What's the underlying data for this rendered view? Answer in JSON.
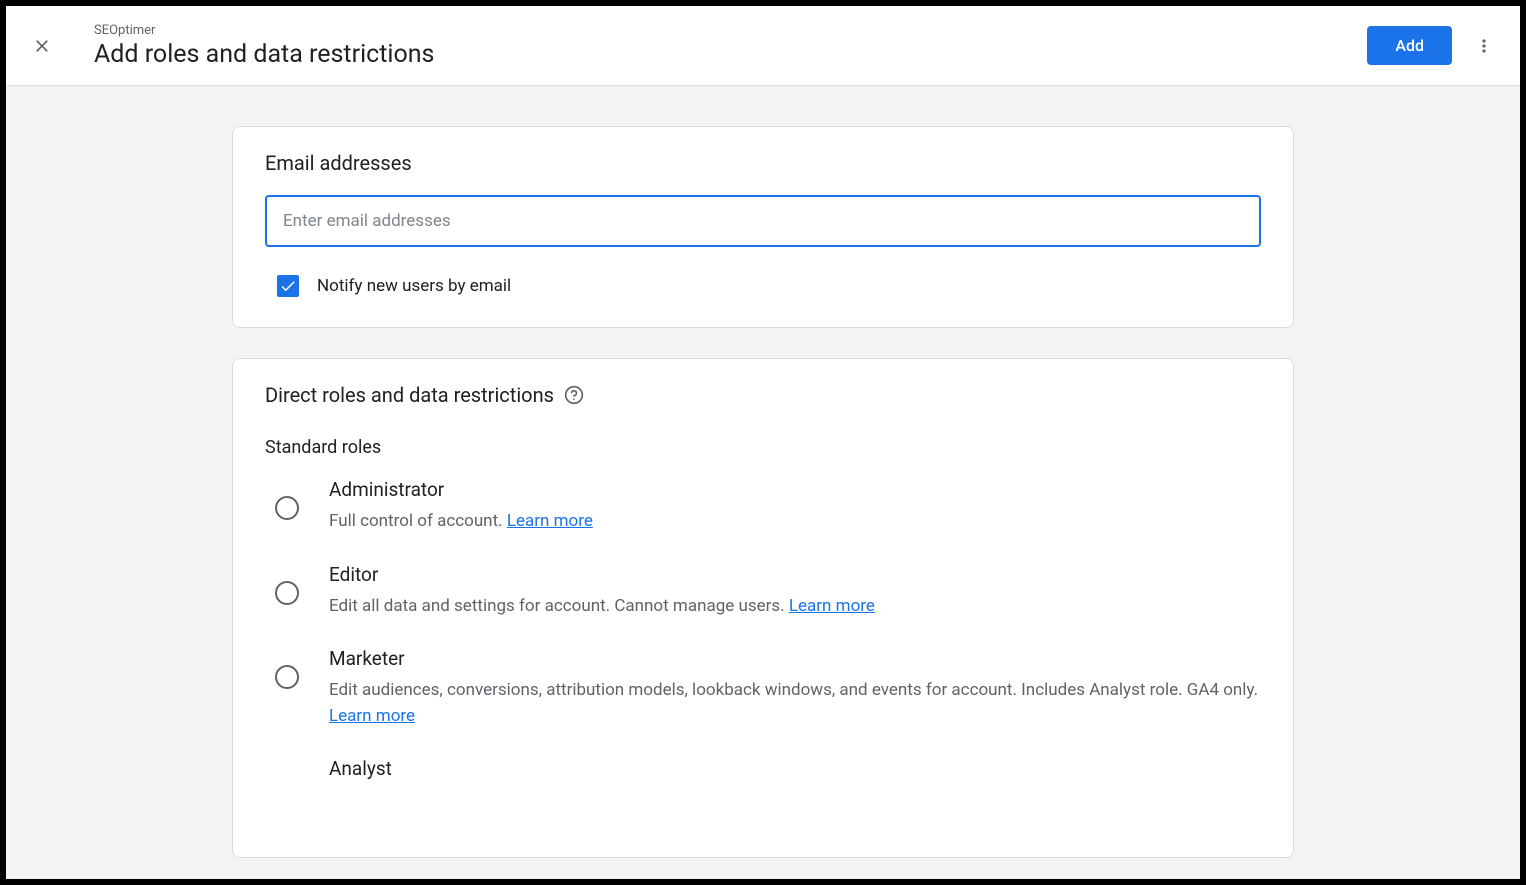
{
  "header": {
    "breadcrumb": "SEOptimer",
    "title": "Add roles and data restrictions",
    "add_button": "Add"
  },
  "email_section": {
    "heading": "Email addresses",
    "placeholder": "Enter email addresses",
    "notify_label": "Notify new users by email",
    "notify_checked": true
  },
  "roles_section": {
    "heading": "Direct roles and data restrictions",
    "subheading": "Standard roles",
    "learn_more": "Learn more",
    "roles": [
      {
        "title": "Administrator",
        "desc": "Full control of account. "
      },
      {
        "title": "Editor",
        "desc": "Edit all data and settings for account. Cannot manage users. "
      },
      {
        "title": "Marketer",
        "desc": "Edit audiences, conversions, attribution models, lookback windows, and events for account. Includes Analyst role. GA4 only. "
      },
      {
        "title": "Analyst",
        "desc": ""
      }
    ]
  }
}
